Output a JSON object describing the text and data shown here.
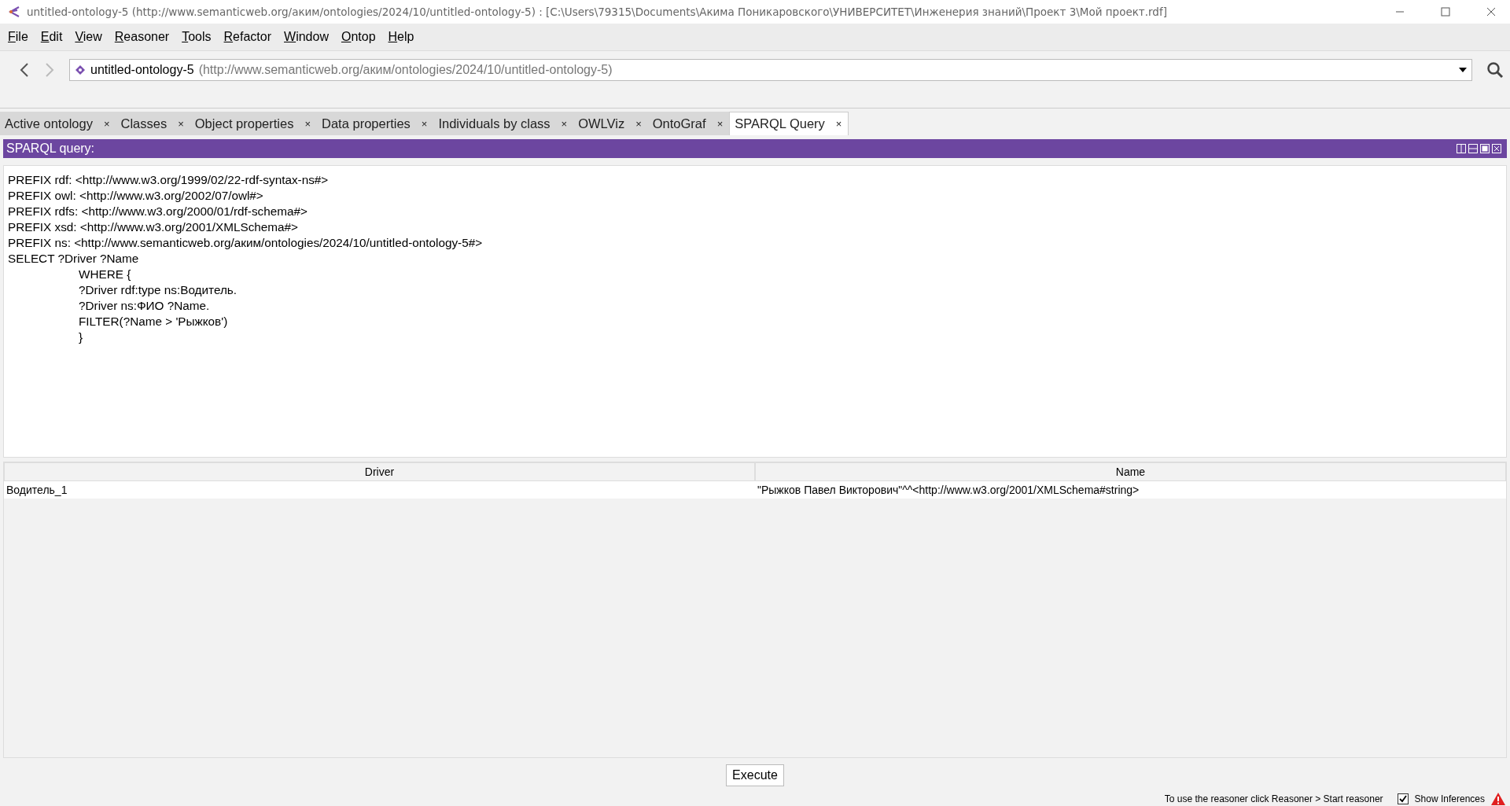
{
  "window": {
    "title": "untitled-ontology-5 (http://www.semanticweb.org/аким/ontologies/2024/10/untitled-ontology-5)  : [C:\\Users\\79315\\Documents\\Акима Поникаровского\\УНИВЕРСИТЕТ\\Инженерия знаний\\Проект 3\\Мой проект.rdf]"
  },
  "menu": [
    "File",
    "Edit",
    "View",
    "Reasoner",
    "Tools",
    "Refactor",
    "Window",
    "Ontop",
    "Help"
  ],
  "address": {
    "name": "untitled-ontology-5",
    "iri": "(http://www.semanticweb.org/аким/ontologies/2024/10/untitled-ontology-5)"
  },
  "tabs": [
    {
      "label": "Active ontology",
      "close": "×",
      "selected": false
    },
    {
      "label": "Classes",
      "close": "×",
      "selected": false
    },
    {
      "label": "Object properties",
      "close": "×",
      "selected": false
    },
    {
      "label": "Data properties",
      "close": "×",
      "selected": false
    },
    {
      "label": "Individuals by class",
      "close": "×",
      "selected": false
    },
    {
      "label": "OWLViz",
      "close": "×",
      "selected": false
    },
    {
      "label": "OntoGraf",
      "close": "×",
      "selected": false
    },
    {
      "label": "SPARQL Query",
      "close": "×",
      "selected": true
    }
  ],
  "panel": {
    "title": "SPARQL query:"
  },
  "query_lines": [
    {
      "text": "PREFIX rdf: <http://www.w3.org/1999/02/22-rdf-syntax-ns#>",
      "indented": false
    },
    {
      "text": "PREFIX owl: <http://www.w3.org/2002/07/owl#>",
      "indented": false
    },
    {
      "text": "PREFIX rdfs: <http://www.w3.org/2000/01/rdf-schema#>",
      "indented": false
    },
    {
      "text": "PREFIX xsd: <http://www.w3.org/2001/XMLSchema#>",
      "indented": false
    },
    {
      "text": "PREFIX ns: <http://www.semanticweb.org/аким/ontologies/2024/10/untitled-ontology-5#>",
      "indented": false
    },
    {
      "text": "SELECT ?Driver ?Name",
      "indented": false
    },
    {
      "text": "WHERE {",
      "indented": true
    },
    {
      "text": "?Driver rdf:type ns:Водитель.",
      "indented": true
    },
    {
      "text": "?Driver ns:ФИО ?Name.",
      "indented": true
    },
    {
      "text": "FILTER(?Name > 'Рыжков')",
      "indented": true
    },
    {
      "text": "}",
      "indented": true
    }
  ],
  "table": {
    "columns": [
      "Driver",
      "Name"
    ],
    "rows": [
      [
        "Водитель_1",
        "\"Рыжков Павел Викторович\"^^<http://www.w3.org/2001/XMLSchema#string>"
      ]
    ]
  },
  "execute_button": "Execute",
  "status_bar": {
    "hint": "To use the reasoner click Reasoner > Start reasoner",
    "show_inferences": {
      "label": "Show Inferences",
      "checked": true
    }
  }
}
